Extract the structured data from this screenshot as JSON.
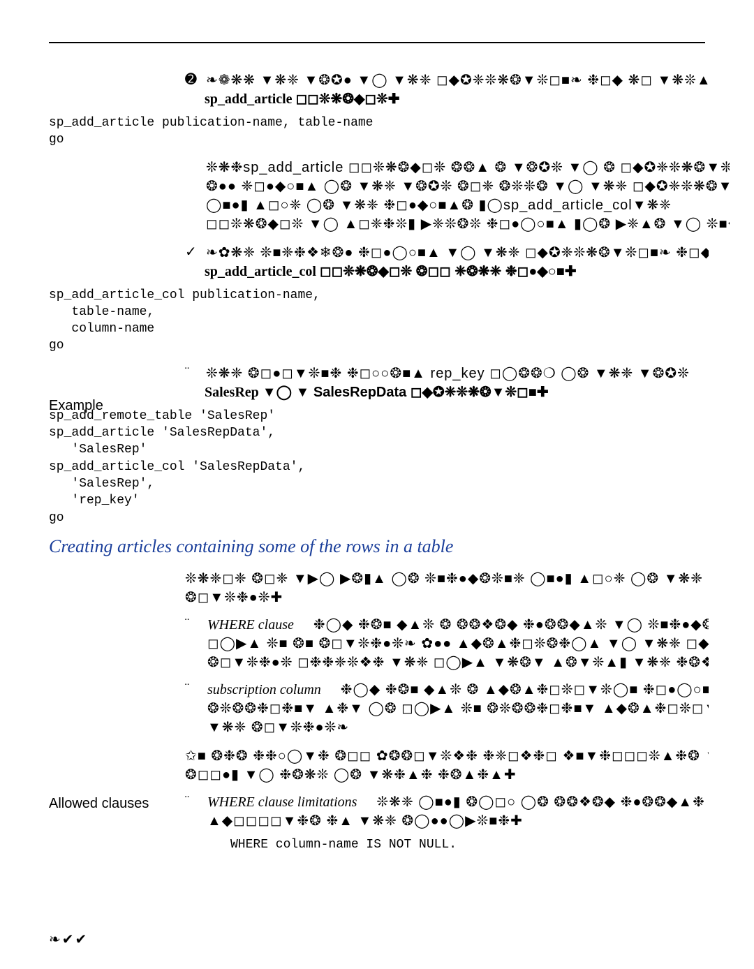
{
  "block1": {
    "bullet": "➋",
    "gibber1": "❧❁❋❋ ▼❋❈ ▼❂✪● ▼◯ ▼❋❈ ◻◆✪❈❊❋❂▼❊◻■❧ ❉◻◆ ❋◻ ▼❋❊▲ ✪▮ ❉❋❋❈",
    "bold_sp": "sp_add_article ",
    "bold_sym": "◻◻❊❋❂◆◻❊✚",
    "code": "sp_add_article publication-name, table-name\ngo",
    "g2": "❊❋❉sp_add_article ◻◻❊❋❂◆◻❊ ❂❂▲ ❂ ▼❂✪❊ ▼◯ ❂ ◻◆✪❈❊❋❂▼❊◻",
    "g3": "❂●● ❈◻●◆○■▲ ◯❂ ▼❋❈ ▼❂✪❊ ❂◻❈ ❂❊❊❂ ▼◯ ▼❋❈ ◻◆✪❈❊❋❂▼❊◻",
    "g4": "◯■●▮ ▲◻○❈ ◯❂ ▼❋❈ ❉◻●◆○■▲❂ ▮◯sp_add_article_col▼❋❈",
    "g5": "◻◻❊❋❂◆◻❊ ▼◯ ▲◻❈❉❊▮ ▶❈❊❂❊ ❉◻●◯○■▲ ▮◯❂ ▶❈▲❂ ▼◯ ❊■❉●◆❂"
  },
  "block2": {
    "bullet": "✓",
    "gibber1": "❧✿❋❈ ❊■❈❉❖❄❂● ❉◻●◯○■▲ ▼◯ ▼❋❈ ◻◆✪❈❊❋❂▼❊◻■❧ ❉◻◆ ❋◯ ▼",
    "bold_sp": "sp_add_article_col ",
    "bold_sym": "◻◻❊❋❂◆◻❊ ❂◻◻ ❈❂❋❈ ❉◻●◆○■✚",
    "code": "sp_add_article_col publication-name,\n   table-name,\n   column-name\ngo"
  },
  "example": {
    "label": "Example",
    "bullet": "¨",
    "g1": "❊❋❈ ❂◻●◻▼❊■❉ ❉◻○○❂■▲ rep_key ◻◯❂❂❍ ◯❂ ▼❋❈ ▼❂✪❊",
    "bold_a": "SalesRep ",
    "bold_mid": "▼◯ ▼ SalesRepData ",
    "bold_sym": "◻◆✪❈❊❋❂▼❊◻■✚",
    "code": "sp_add_remote_table 'SalesRep'\nsp_add_article 'SalesRepData',\n   'SalesRep'\nsp_add_article_col 'SalesRepData',\n   'SalesRep',\n   'rep_key'\ngo"
  },
  "section_head": "Creating articles containing some of the rows in a table",
  "afterhead": {
    "g1": "❊❋❈◻❈ ❂◻❈ ▼▶◯ ▶❂▮▲ ◯❂ ❊■❉●◆❂❊■❈ ◯■●▮ ▲◻○❈ ◯❂ ▼❋❈ ◻◯▶▲ ❂◻◯",
    "g2": "❂◻▼❊❉●❊✚"
  },
  "bullets": [
    {
      "mark": "¨",
      "term": "WHERE clause",
      "g1": "❉◯◆ ❉❂■ ◆▲❊ ❂ ❂❂❖❂◆ ❉●❂❂◆▲❊ ▼◯ ❊■❉●◆❂❊ ❂ ▲◆",
      "g2": "◻◯▶▲ ❊■ ❂■ ❂◻▼❊❉●❊❧ ✿●● ▲◆❂▲❉◻❊❂❉◯▲ ▼◯ ▼❋❈ ◻◆✪❈❊❋❉▼",
      "g3": "❂◻▼❊❉●❊ ◻❉❉❈❊❖❉ ▼❋❈ ◻◯▶▲ ▼❋❂▼ ▲❂▼❊▲▮ ▼❋❈ ❉❂❖❂◆ ❉●❂"
    },
    {
      "mark": "¨",
      "term": "subscription column",
      "g1": "❉◯◆ ❉❂■ ◆▲❊ ❂ ▲◆❂▲❉◻❊◻▼❊◯■ ❉◻●◯○■ ▼◯",
      "g2": "❂❊❂❂❉◻❉■▼ ▲❉▼ ◯❂ ◻◯▶▲ ❊■ ❂❊❂❂❉◻❉■▼ ▲◆❂▲❉◻❊◻▼❊◯■▲ ▼◯",
      "g3": "▼❋❈ ❂◻▼❊❉●❊❧"
    }
  ],
  "allowed": {
    "label": "Allowed clauses",
    "g1": "✩■ ❂❉❂ ❉❉○◯▼❉ ❂◻◻ ✿❂❂◻▼❊❖❉ ❉❈◻❖❉◻ ❖■▼❉◻◻◻❊▲❉❂ ▼❋❈ ❂◯●",
    "g2": "❂◻◻●▮ ▼◯ ❉❂❋❊ ◯❂ ▼❋❉▲❉ ❉❂▲❉▲✚",
    "sub_term": "WHERE clause limitations",
    "sub_mark": "¨",
    "sub_g1": "❊❋❈ ◯■●▮ ❂◯◻○ ◯❂ ❂❂❖❂◆ ❉●❂❂◆▲❉",
    "sub_g2": "▲◆◻◻◻◻▼❉❂ ❉▲ ▼❋❈ ❂◯●●◯▶❊■❉✚",
    "code": "WHERE column-name IS NOT NULL."
  },
  "page_num": "❧✔✔"
}
